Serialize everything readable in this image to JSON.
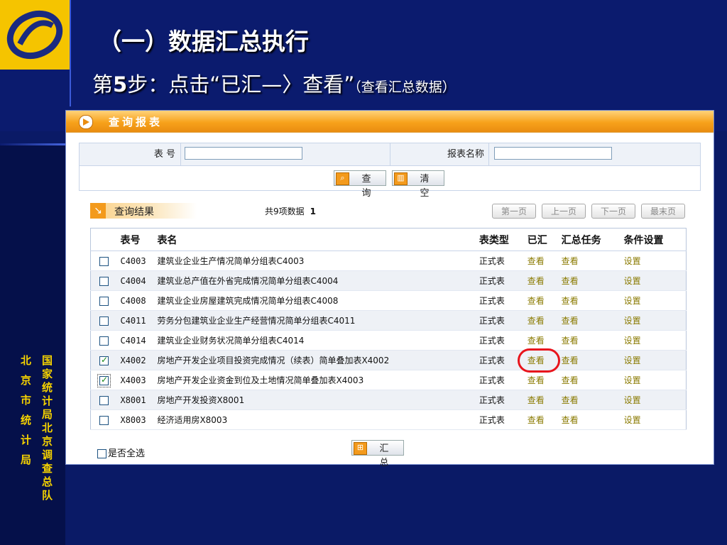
{
  "slide": {
    "title": "（一）数据汇总执行",
    "step_prefix": "第",
    "step_num": "5",
    "step_text": "步：点击“已汇—〉查看”",
    "step_note": "（查看汇总数据）",
    "side_org": "国家统计局北京调查总队",
    "side_org2": "北京市统计局"
  },
  "window": {
    "title": "查询报表"
  },
  "query": {
    "code_label": "表 号",
    "code_value": "",
    "name_label": "报表名称",
    "name_value": "",
    "search_button": "查 询",
    "clear_button": "清 空"
  },
  "results": {
    "label": "查询结果",
    "count_text": "共9项数据",
    "page": "1",
    "first_page": "第一页",
    "prev_page": "上一页",
    "next_page": "下一页",
    "last_page": "最末页"
  },
  "table": {
    "headers": [
      "表号",
      "表名",
      "表类型",
      "已汇",
      "汇总任务",
      "条件设置"
    ],
    "rows": [
      {
        "code": "C4003",
        "name": "建筑业企业生产情况简单分组表C4003",
        "type": "正式表",
        "summed": "查看",
        "task": "查看",
        "setting": "设置",
        "checked": false
      },
      {
        "code": "C4004",
        "name": "建筑业总产值在外省完成情况简单分组表C4004",
        "type": "正式表",
        "summed": "查看",
        "task": "查看",
        "setting": "设置",
        "checked": false
      },
      {
        "code": "C4008",
        "name": "建筑业企业房屋建筑完成情况简单分组表C4008",
        "type": "正式表",
        "summed": "查看",
        "task": "查看",
        "setting": "设置",
        "checked": false
      },
      {
        "code": "C4011",
        "name": "劳务分包建筑业企业生产经营情况简单分组表C4011",
        "type": "正式表",
        "summed": "查看",
        "task": "查看",
        "setting": "设置",
        "checked": false
      },
      {
        "code": "C4014",
        "name": "建筑业企业财务状况简单分组表C4014",
        "type": "正式表",
        "summed": "查看",
        "task": "查看",
        "setting": "设置",
        "checked": false
      },
      {
        "code": "X4002",
        "name": "房地产开发企业项目投资完成情况（续表）简单叠加表X4002",
        "type": "正式表",
        "summed": "查看",
        "task": "查看",
        "setting": "设置",
        "checked": true
      },
      {
        "code": "X4003",
        "name": "房地产开发企业资金到位及土地情况简单叠加表X4003",
        "type": "正式表",
        "summed": "查看",
        "task": "查看",
        "setting": "设置",
        "checked": true
      },
      {
        "code": "X8001",
        "name": "房地产开发投资X8001",
        "type": "正式表",
        "summed": "查看",
        "task": "查看",
        "setting": "设置",
        "checked": false
      },
      {
        "code": "X8003",
        "name": "经济适用房X8003",
        "type": "正式表",
        "summed": "查看",
        "task": "查看",
        "setting": "设置",
        "checked": false
      }
    ]
  },
  "footer": {
    "select_all": "是否全选",
    "summary_button": "汇 总"
  },
  "colors": {
    "slide_bg": "#0a1a66",
    "accent_orange": "#f39a1c",
    "highlight_red": "#e8141c",
    "link_olive": "#8a7a00"
  }
}
